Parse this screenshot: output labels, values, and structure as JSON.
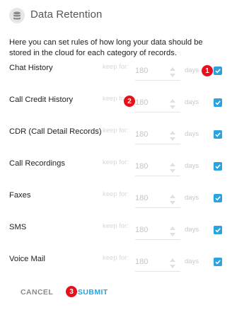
{
  "header": {
    "title": "Data Retention",
    "icon": "database-icon"
  },
  "description": "Here you can set rules of how long your data should be stored in the cloud for each category of records.",
  "rows": [
    {
      "label": "Chat History",
      "keep_label": "keep for:",
      "value": "180",
      "unit": "days",
      "checked": true
    },
    {
      "label": "Call Credit History",
      "keep_label": "keep for:",
      "value": "180",
      "unit": "days",
      "checked": true
    },
    {
      "label": "CDR (Call Detail Records)",
      "keep_label": "keep for:",
      "value": "180",
      "unit": "days",
      "checked": true
    },
    {
      "label": "Call Recordings",
      "keep_label": "keep for:",
      "value": "180",
      "unit": "days",
      "checked": true
    },
    {
      "label": "Faxes",
      "keep_label": "keep for:",
      "value": "180",
      "unit": "days",
      "checked": true
    },
    {
      "label": "SMS",
      "keep_label": "keep for:",
      "value": "180",
      "unit": "days",
      "checked": true
    },
    {
      "label": "Voice Mail",
      "keep_label": "keep for:",
      "value": "180",
      "unit": "days",
      "checked": true
    }
  ],
  "badges": [
    "1",
    "2",
    "3"
  ],
  "actions": {
    "cancel": "CANCEL",
    "submit": "SUBMIT"
  },
  "colors": {
    "accent": "#2aa3e0",
    "badge": "#e8101a"
  }
}
